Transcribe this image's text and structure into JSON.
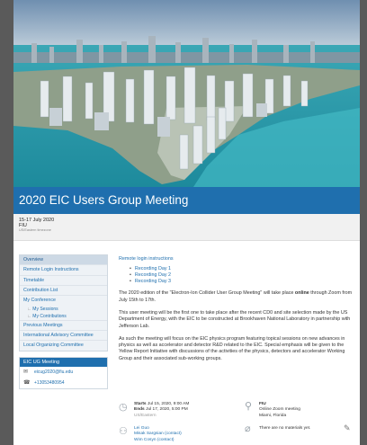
{
  "event": {
    "title": "2020 EIC Users Group Meeting",
    "dates": "15-17 July 2020",
    "location": "FIU",
    "timezone": "US/Eastern timezone"
  },
  "sidebar": {
    "items": [
      "Overview",
      "Remote Login Instructions",
      "Timetable",
      "Contribution List",
      "My Conference"
    ],
    "subitems": [
      "My Sessions",
      "My Contributions"
    ],
    "items2": [
      "Previous Meetings",
      "International Advisory Committee",
      "Local Organizing Committee"
    ],
    "contact_title": "EIC UG Meeting",
    "email": "eicug2020@fiu.edu",
    "phone": "+13053480954"
  },
  "main": {
    "remote_link": "Remote login instructions",
    "recordings": [
      "Recording Day 1",
      "Recording Day 2",
      "Recording Day 3"
    ],
    "p1_a": "The 2020 edition of the \"Electron-Ion Collider User Group Meeting\" will take place ",
    "p1_b": "online",
    "p1_c": " through Zoom from July 15th to 17th.",
    "p2": "This user meeting will be the first one to take place after the recent CD0 and site selection made by the US Department of Energy, with the EIC to be constructed at Brookhaven National Laboratory in partnership with Jefferson Lab.",
    "p3": "As such the meeting will focus on the EIC physics program featuring topical sessions on new advances in physics as well as accelerator and detector R&D related to the EIC.  Special emphasis will be given to the Yellow Report Initiative with discussions of the activities of the physics, detectors and accelerator Working Group and their associated sub-working groups."
  },
  "meta": {
    "starts_label": "Starts",
    "starts": " Jul 15, 2020, 9:00 AM",
    "ends_label": "Ends",
    "ends": " Jul 17, 2020, 5:00 PM",
    "tz": "US/Eastern",
    "venue": "FIU",
    "venue_line2": "Online Zoom meeting",
    "venue_line3": "Miami, Florida",
    "chairs": [
      "Lei Guo",
      "Misak Sargsian (contact)",
      "Wim Cosyn (contact)"
    ],
    "materials": "There are no materials yet."
  },
  "icons": {
    "clock": "clock-icon",
    "pin": "location-pin-icon",
    "people": "chairperson-icon",
    "clip": "paperclip-icon",
    "edit": "pencil-edit-icon",
    "mail": "envelope-icon",
    "phone": "phone-icon"
  },
  "colors": {
    "brand": "#1f6fae",
    "page_bg": "#5a5a5a"
  }
}
